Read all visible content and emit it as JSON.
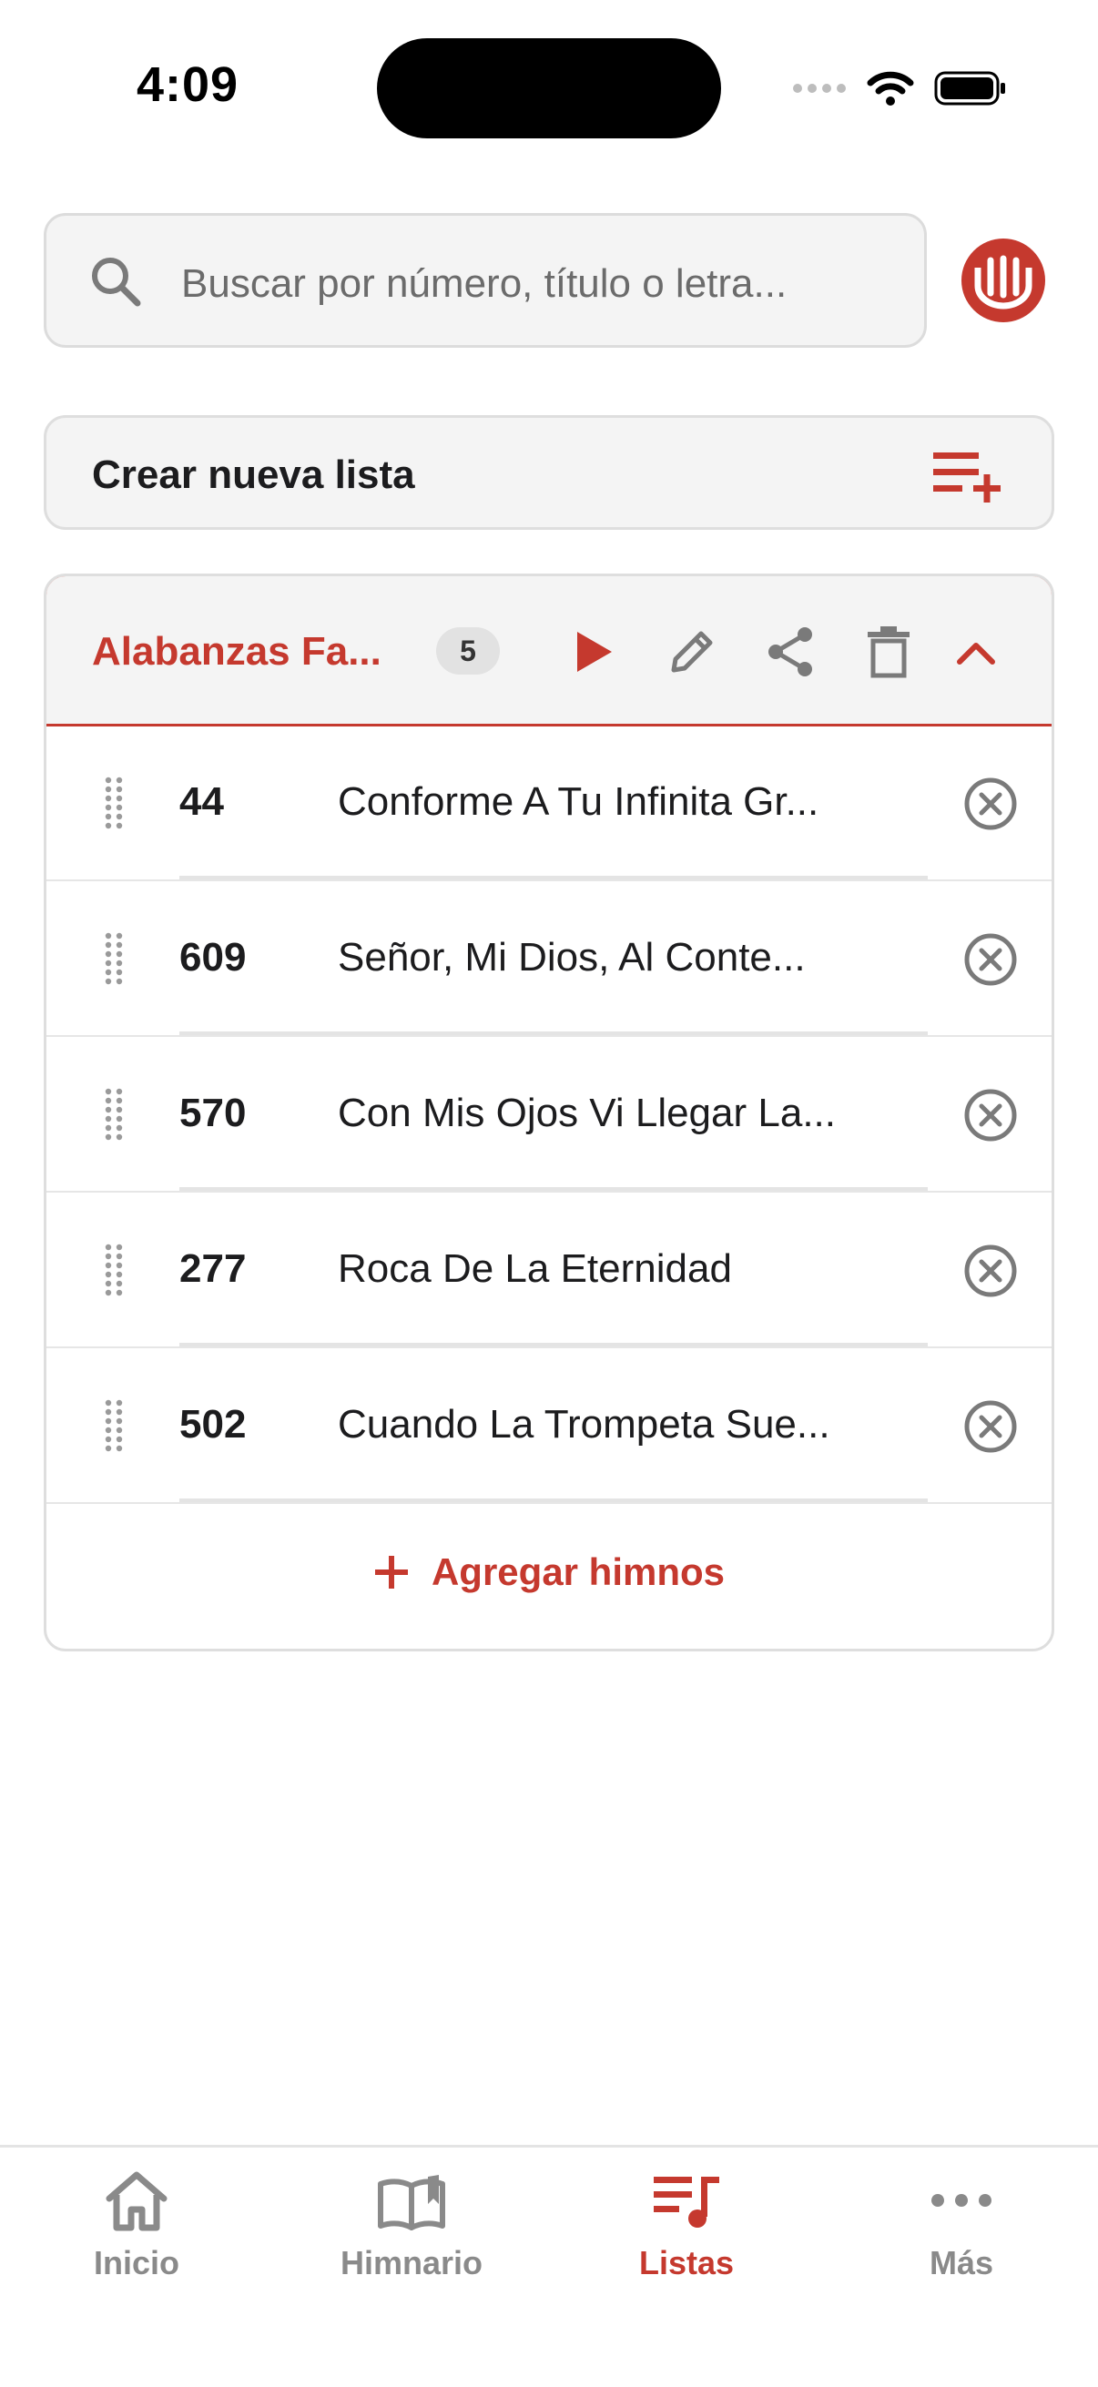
{
  "status_bar": {
    "time": "4:09"
  },
  "search": {
    "placeholder": "Buscar por número, título o letra..."
  },
  "create_list": {
    "label": "Crear nueva lista"
  },
  "playlist": {
    "title": "Alabanzas Fa...",
    "count": "5",
    "songs": [
      {
        "number": "44",
        "title": "Conforme A Tu Infinita Gr..."
      },
      {
        "number": "609",
        "title": "Señor, Mi Dios, Al Conte..."
      },
      {
        "number": "570",
        "title": "Con Mis Ojos Vi Llegar La..."
      },
      {
        "number": "277",
        "title": "Roca De La Eternidad"
      },
      {
        "number": "502",
        "title": "Cuando La Trompeta Sue..."
      }
    ],
    "add_label": "Agregar himnos"
  },
  "tabs": [
    {
      "label": "Inicio",
      "icon": "home-icon",
      "active": false
    },
    {
      "label": "Himnario",
      "icon": "book-icon",
      "active": false
    },
    {
      "label": "Listas",
      "icon": "playlist-music-icon",
      "active": true
    },
    {
      "label": "Más",
      "icon": "more-icon",
      "active": false
    }
  ],
  "colors": {
    "accent": "#c5392e",
    "muted": "#8a8a8a",
    "surface": "#f4f4f4"
  }
}
